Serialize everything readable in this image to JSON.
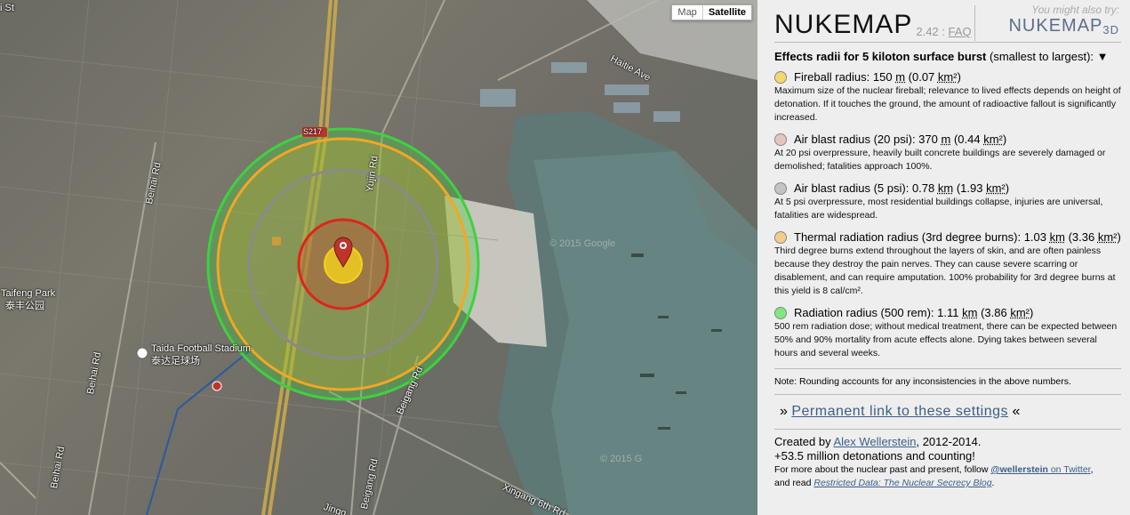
{
  "map": {
    "toggle": {
      "map": "Map",
      "satellite": "Satellite"
    },
    "labels": {
      "haitie": "Haitie Ave",
      "s217": "S217",
      "yujin": "Yujin Rd",
      "beihai1": "Beihai Rd",
      "beihai2": "Beihai Rd",
      "beihai3": "Beihai Rd",
      "beihai4": "Beihai Rd",
      "taifeng_en": "Taifeng Park",
      "taifeng_zh": "泰丰公园",
      "taida_en": "Taida Football Stadium",
      "taida_zh": "泰达足球场",
      "beigang1": "Beigang Rd",
      "beigang2": "Beigang Rd",
      "xingang": "Xingang 6th Rd",
      "jing": "Jingg",
      "st": "i St",
      "wm1": "© 2015 Google",
      "wm2": "© 2015 G"
    },
    "colors": {
      "radiation": "#3fd13f",
      "thermal": "#f5a623",
      "blast5": "#8a8a8a",
      "blast20": "#e0241b",
      "fireball": "#f5d21c"
    }
  },
  "panel": {
    "logo": "NUKEMAP",
    "version": "2.42",
    "sep": ":",
    "faq": "FAQ",
    "also_try": "You might also try:",
    "nuke3d": "NUKEMAP",
    "nuke3d_sub": "3D",
    "effects_title_bold": "Effects radii for 5 kiloton surface burst",
    "effects_title_rest": " (smallest to largest): ▼",
    "effects": [
      {
        "label": "Fireball radius: ",
        "value": "150",
        "unit": "m",
        "area": " (0.07 ",
        "area_unit": "km²",
        "close": ")",
        "desc": "Maximum size of the nuclear fireball; relevance to lived effects depends on height of detonation. If it touches the ground, the amount of radioactive fallout is significantly increased."
      },
      {
        "label": "Air blast radius (20 psi): ",
        "value": "370",
        "unit": "m",
        "area": " (0.44 ",
        "area_unit": "km²",
        "close": ")",
        "desc": "At 20 psi overpressure, heavily built concrete buildings are severely damaged or demolished; fatalities approach 100%."
      },
      {
        "label": "Air blast radius (5 psi): ",
        "value": "0.78",
        "unit": "km",
        "area": " (1.93 ",
        "area_unit": "km²",
        "close": ")",
        "desc": "At 5 psi overpressure, most residential buildings collapse, injuries are universal, fatalities are widespread."
      },
      {
        "label": "Thermal radiation radius (3rd degree burns): ",
        "value": "1.03",
        "unit": "km",
        "area": " (3.36 ",
        "area_unit": "km²",
        "close": ")",
        "desc": "Third degree burns extend throughout the layers of skin, and are often painless because they destroy the pain nerves. They can cause severe scarring or disablement, and can require amputation. 100% probability for 3rd degree burns at this yield is 8 cal/cm²."
      },
      {
        "label": "Radiation radius (500 rem): ",
        "value": "1.11",
        "unit": "km",
        "area": " (3.86 ",
        "area_unit": "km²",
        "close": ")",
        "desc": "500 rem radiation dose; without medical treatment, there can be expected between 50% and 90% mortality from acute effects alone. Dying takes between several hours and several weeks."
      }
    ],
    "note": "Note: Rounding accounts for any inconsistencies in the above numbers.",
    "permalink_pre": "» ",
    "permalink": "Permanent link to these settings",
    "permalink_post": " «",
    "created_pre": "Created by ",
    "author": "Alex Wellerstein",
    "created_post": ", 2012-2014.",
    "detonations": "+53.5 million detonations and counting!",
    "more_pre": "For more about the nuclear past and present, follow ",
    "twitter_handle": "@wellerstein",
    "twitter_post": " on Twitter",
    "more_mid": ",",
    "read_pre": "and read ",
    "blog": "Restricted Data: The Nuclear Secrecy Blog",
    "read_post": "."
  }
}
